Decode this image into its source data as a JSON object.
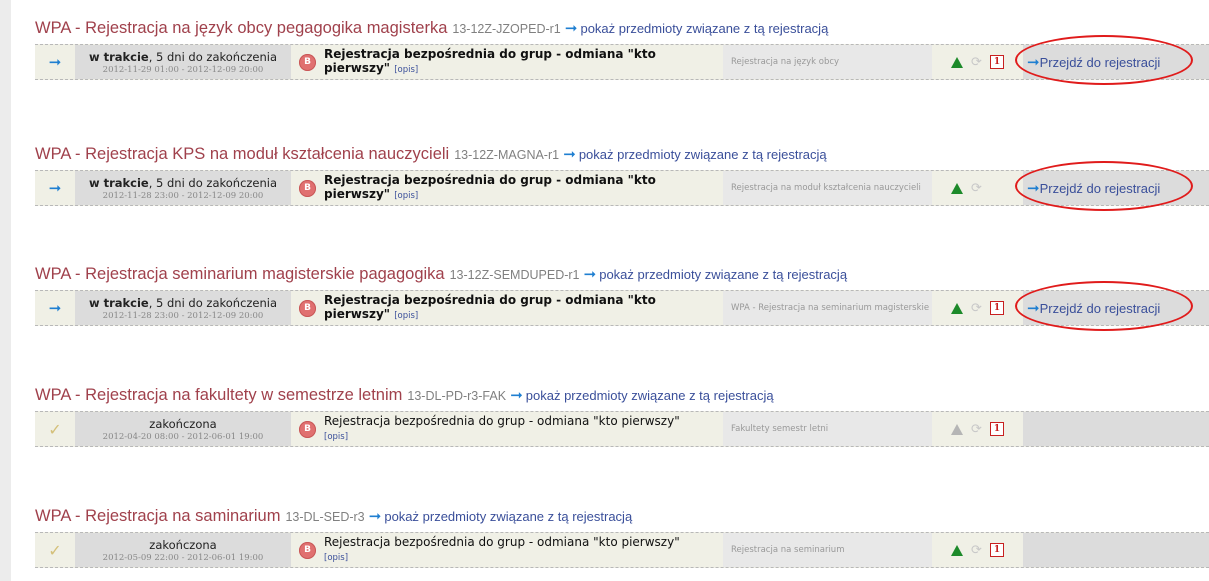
{
  "registrations": [
    {
      "title": "WPA - Rejestracja na język obcy pegagogika magisterka",
      "code": "13-12Z-JZOPED-r1",
      "link_label": "pokaż przedmioty związane z tą rejestracją",
      "status_icon": "arrow-right-icon",
      "status_bold": "w trakcie",
      "status_rest": ", 5 dni do zakończenia",
      "dates": "2012-11-29 01:00 - 2012-12-09 20:00",
      "type_text": "Rejestracja bezpośrednia do grup - odmiana \"kto pierwszy\"",
      "type_bold": true,
      "opis": "[opis]",
      "description": "Rejestracja na język obcy",
      "triangle": "green",
      "one_badge": "1",
      "go_label": "Przejdź do rejestracji"
    },
    {
      "title": "WPA - Rejestracja KPS na moduł kształcenia nauczycieli",
      "code": "13-12Z-MAGNA-r1",
      "link_label": "pokaż przedmioty związane z tą rejestracją",
      "status_icon": "arrow-right-icon",
      "status_bold": "w trakcie",
      "status_rest": ", 5 dni do zakończenia",
      "dates": "2012-11-28 23:00 - 2012-12-09 20:00",
      "type_text": "Rejestracja bezpośrednia do grup - odmiana \"kto pierwszy\"",
      "type_bold": true,
      "opis": "[opis]",
      "description": "Rejestracja na moduł kształcenia nauczycieli",
      "triangle": "green",
      "one_badge": "",
      "go_label": "Przejdź do rejestracji"
    },
    {
      "title": "WPA - Rejestracja seminarium magisterskie pagagogika",
      "code": "13-12Z-SEMDUPED-r1",
      "link_label": "pokaż przedmioty związane z tą rejestracją",
      "status_icon": "arrow-right-icon",
      "status_bold": "w trakcie",
      "status_rest": ", 5 dni do zakończenia",
      "dates": "2012-11-28 23:00 - 2012-12-09 20:00",
      "type_text": "Rejestracja bezpośrednia do grup - odmiana \"kto pierwszy\"",
      "type_bold": true,
      "opis": "[opis]",
      "description": "WPA - Rejestracja na seminarium magisterskie",
      "triangle": "green",
      "one_badge": "1",
      "go_label": "Przejdź do rejestracji"
    },
    {
      "title": "WPA - Rejestracja na fakultety w semestrze letnim",
      "code": "13-DL-PD-r3-FAK",
      "link_label": "pokaż przedmioty związane z tą rejestracją",
      "status_icon": "checkmark-icon",
      "status_bold": "",
      "status_rest": "zakończona",
      "dates": "2012-04-20 08:00 - 2012-06-01 19:00",
      "type_text": "Rejestracja bezpośrednia do grup - odmiana \"kto pierwszy\"",
      "type_bold": false,
      "opis": "[opis]",
      "description": "Fakultety semestr letni",
      "triangle": "grey",
      "one_badge": "1",
      "go_label": ""
    },
    {
      "title": "WPA - Rejestracja na saminarium",
      "code": "13-DL-SED-r3",
      "link_label": "pokaż przedmioty związane z tą rejestracją",
      "status_icon": "checkmark-icon",
      "status_bold": "",
      "status_rest": "zakończona",
      "dates": "2012-05-09 22:00 - 2012-06-01 19:00",
      "type_text": "Rejestracja bezpośrednia do grup - odmiana \"kto pierwszy\"",
      "type_bold": false,
      "opis": "[opis]",
      "description": "Rejestracja na seminarium",
      "triangle": "green",
      "one_badge": "1",
      "go_label": ""
    }
  ],
  "colors": {
    "title": "#a0414c",
    "link": "#3a4f9a",
    "arrow": "#1f7fd1",
    "highlight_ellipse": "#e01b1b"
  },
  "badge_letter": "B"
}
